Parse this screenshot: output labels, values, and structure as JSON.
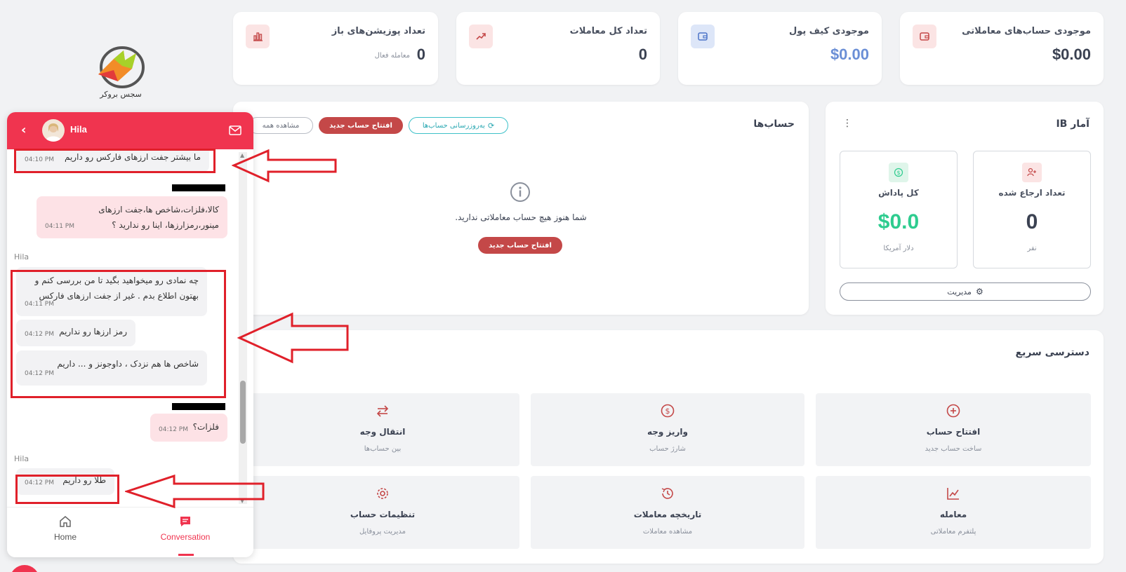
{
  "stats": [
    {
      "title": "موجودی حساب‌های معاملاتی",
      "value": "$0.00"
    },
    {
      "title": "موجودی کیف پول",
      "value": "$0.00"
    },
    {
      "title": "تعداد کل معاملات",
      "value": "0"
    },
    {
      "title": "تعداد پوزیشن‌های باز",
      "value": "0",
      "sub": "معامله فعال"
    }
  ],
  "logo": {
    "text": "سجس بروکر"
  },
  "accounts": {
    "title": "حساب‌ها",
    "refresh_label": "به‌روزرسانی حساب‌ها",
    "new_account_label": "افتتاح حساب جدید",
    "view_all_label": "مشاهده همه",
    "empty_text": "شما هنوز هیچ حساب معاملاتی ندارید.",
    "empty_button": "افتتاح حساب جدید"
  },
  "ib": {
    "title": "آمار IB",
    "referred": {
      "label": "تعداد ارجاع شده",
      "value": "0",
      "unit": "نفر"
    },
    "reward": {
      "label": "کل پاداش",
      "value": "$0.0",
      "unit": "دلار آمریکا"
    },
    "manage_label": "مدیریت"
  },
  "quick_access": {
    "title": "دسترسی سریع",
    "items": [
      {
        "title": "افتتاح حساب",
        "sub": "ساخت حساب جدید"
      },
      {
        "title": "واریز وجه",
        "sub": "شارژ حساب"
      },
      {
        "title": "انتقال وجه",
        "sub": "بین حساب‌ها"
      },
      {
        "title": "معامله",
        "sub": "پلتفرم معاملاتی"
      },
      {
        "title": "تاریخچه معاملات",
        "sub": "مشاهده معاملات"
      },
      {
        "title": "تنظیمات حساب",
        "sub": "مدیریت پروفایل"
      }
    ]
  },
  "chat": {
    "agent_name": "Hila",
    "messages": [
      {
        "sender": "",
        "text": "ما بیشتر جفت ارزهای فارکس رو داریم",
        "time": "04:10 PM"
      },
      {
        "sender": "",
        "text": "کالا،فلزات،شاخص ها،جفت ارزهای مینور،رمزارزها، اینا رو ندارید ؟",
        "time": "04:11 PM"
      },
      {
        "sender": "Hila",
        "text": "چه نمادی رو میخواهید بگید تا من بررسی کنم و بهتون اطلاع بدم . غیر از جفت ارزهای فارکس",
        "time": "04:11 PM"
      },
      {
        "sender": "",
        "text": "رمز ارزها رو نداریم",
        "time": "04:12 PM"
      },
      {
        "sender": "",
        "text": "شاخص ها هم نزدک ، داوجونز و ... داریم",
        "time": "04:12 PM"
      },
      {
        "sender": "",
        "text": "فلزات؟",
        "time": "04:12 PM"
      },
      {
        "sender": "Hila",
        "text": "طلا رو داریم",
        "time": "04:12 PM"
      }
    ],
    "tabs": [
      {
        "label": "Home"
      },
      {
        "label": "Conversation"
      }
    ]
  },
  "colors": {
    "accent": "#f0344f",
    "danger": "#c44848",
    "success": "#2ecc8f",
    "annotation": "#e0202a"
  }
}
